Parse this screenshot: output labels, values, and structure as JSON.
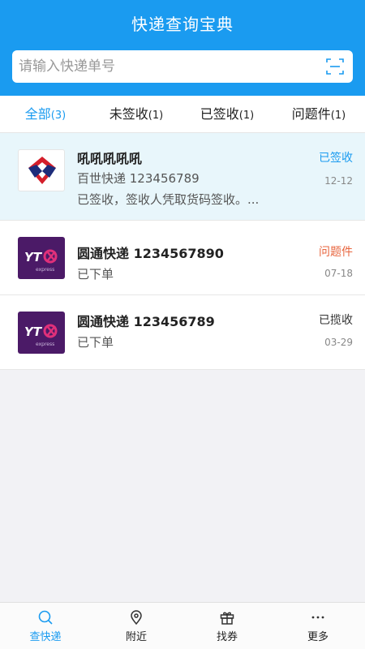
{
  "app": {
    "title": "快递查询宝典"
  },
  "search": {
    "placeholder": "请输入快递单号",
    "icon": "scan-icon"
  },
  "tabs": [
    {
      "label": "全部",
      "count": "(3)",
      "active": true
    },
    {
      "label": "未签收",
      "count": "(1)",
      "active": false
    },
    {
      "label": "已签收",
      "count": "(1)",
      "active": false
    },
    {
      "label": "问题件",
      "count": "(1)",
      "active": false
    }
  ],
  "packages": [
    {
      "name": "吼吼吼吼吼",
      "courier_number": "百世快递 123456789",
      "detail": "已签收，签收人凭取货码签收。...",
      "status": "已签收",
      "status_color": "#1a9bf0",
      "date": "12-12",
      "logo": "best-express-logo"
    },
    {
      "name": "圆通快递 1234567890",
      "courier_number": "",
      "detail": "已下单",
      "status": "问题件",
      "status_color": "#e8663f",
      "date": "07-18",
      "logo": "yto-express-logo"
    },
    {
      "name": "圆通快递 123456789",
      "courier_number": "",
      "detail": "已下单",
      "status": "已揽收",
      "status_color": "#333333",
      "date": "03-29",
      "logo": "yto-express-logo"
    }
  ],
  "bottom_nav": [
    {
      "label": "查快递",
      "icon": "search-icon",
      "active": true
    },
    {
      "label": "附近",
      "icon": "location-pin-icon",
      "active": false
    },
    {
      "label": "找券",
      "icon": "gift-icon",
      "active": false
    },
    {
      "label": "更多",
      "icon": "more-dots-icon",
      "active": false
    }
  ],
  "colors": {
    "primary": "#1a9bf0",
    "highlight_row": "#e8f6fb",
    "yto_purple": "#4b1a67",
    "problem": "#e8663f"
  }
}
